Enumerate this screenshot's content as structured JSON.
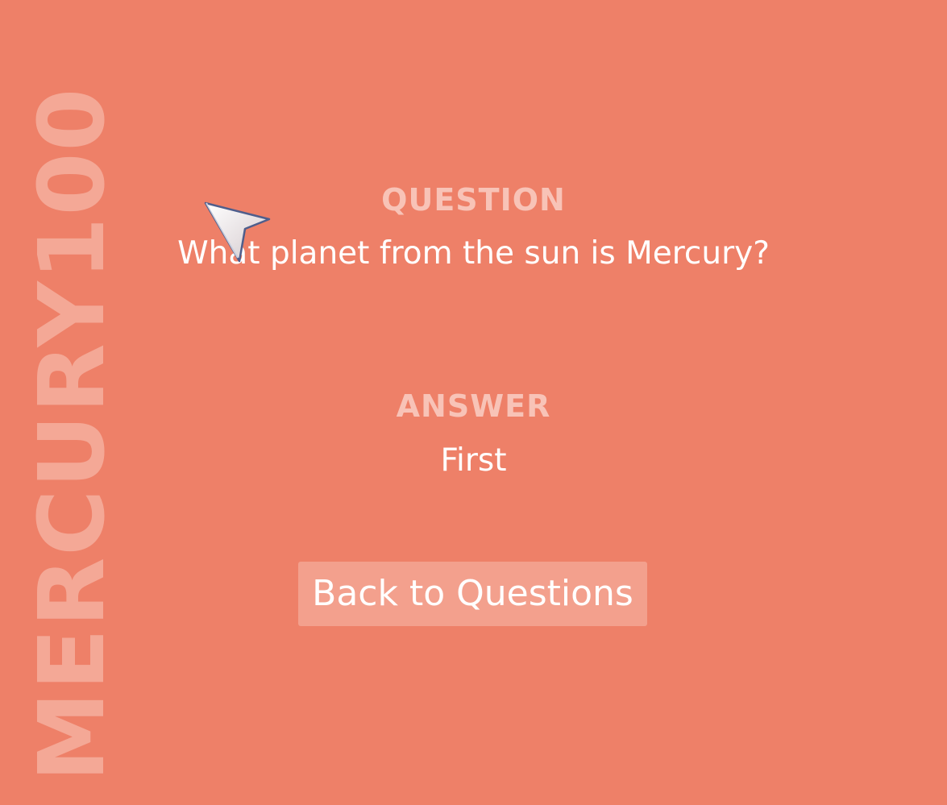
{
  "page": {
    "side_label": "MERCURY100"
  },
  "question": {
    "heading": "QUESTION",
    "text": "What planet from the sun is Mercury?"
  },
  "answer": {
    "heading": "ANSWER",
    "text": "First"
  },
  "actions": {
    "back_label": "Back to Questions"
  },
  "colors": {
    "background": "#ee8068",
    "heading_text": "#f8c3b7",
    "button_background": "#f3a08d",
    "side_label": "#f7b8a9"
  },
  "icons": {
    "cursor": "pointer-cursor-icon"
  }
}
